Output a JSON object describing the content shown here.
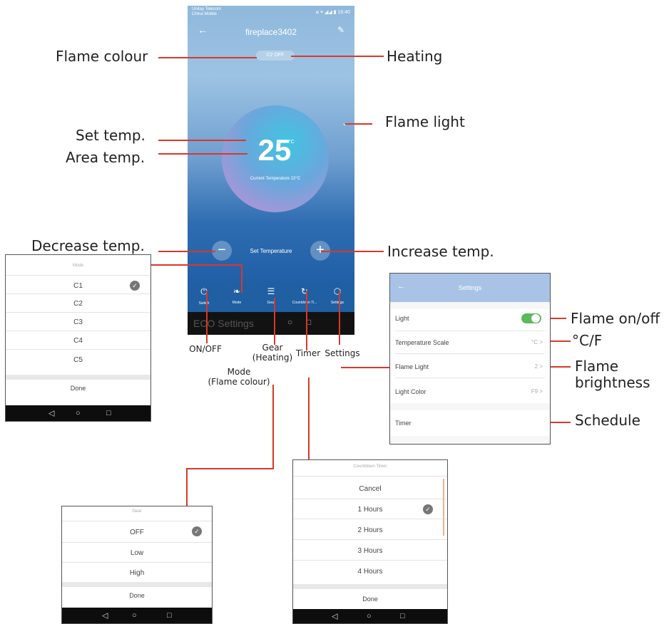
{
  "phone": {
    "status_left_1": "Unitay Telecom",
    "status_left_2": "China Mobile",
    "status_right": "⌀ ≡ ◢◢ ▮ 16:40",
    "title": "fireplace3402",
    "mode_pill": "C2 OFF",
    "set_temp": "25",
    "temp_unit": "°C",
    "current_temp": "Current Temperature 22°C",
    "set_temperature_label": "Set Temperature",
    "tabs": [
      "Switch",
      "Mode",
      "Gear",
      "Countdown Ti...",
      "Settings"
    ],
    "bottom_text": "ECO   Settings"
  },
  "callouts": {
    "flame_colour": "Flame colour",
    "heating": "Heating",
    "flame_light": "Flame light",
    "set_temp": "Set temp.",
    "area_temp": "Area temp.",
    "decrease_temp": "Decrease temp.",
    "increase_temp": "Increase temp.",
    "on_off": "ON/OFF",
    "gear_1": "Gear",
    "gear_2": "(Heating)",
    "timer": "Timer",
    "settings": "Settings",
    "mode_1": "Mode",
    "mode_2": "(Flame colour)",
    "flame_on_off": "Flame on/off",
    "c_f": "°C/F",
    "flame_brightness_1": "Flame",
    "flame_brightness_2": "brightness",
    "schedule": "Schedule"
  },
  "mode_popup": {
    "title": "Mode",
    "options": [
      "C1",
      "C2",
      "C3",
      "C4",
      "C5"
    ],
    "selected": "C1",
    "done": "Done"
  },
  "settings_popup": {
    "title": "Settings",
    "rows": [
      {
        "label": "Light",
        "value": ""
      },
      {
        "label": "Temperature Scale",
        "value": "°C >"
      },
      {
        "label": "Flame Light",
        "value": "2 >"
      },
      {
        "label": "Light Color",
        "value": "F9 >"
      },
      {
        "label": "Timer",
        "value": ""
      }
    ],
    "light_toggle_on": true
  },
  "gear_popup": {
    "title": "Gear",
    "options": [
      "OFF",
      "Low",
      "High"
    ],
    "selected": "OFF",
    "done": "Done"
  },
  "timer_popup": {
    "title": "Countdown Timer",
    "options": [
      "Cancel",
      "1 Hours",
      "2 Hours",
      "3 Hours",
      "4 Hours"
    ],
    "selected": "1 Hours",
    "done": "Done"
  },
  "colors": {
    "callout_line": "#d9382b",
    "toggle_green": "#5cb85c",
    "settings_header": "#a9c3e6"
  }
}
